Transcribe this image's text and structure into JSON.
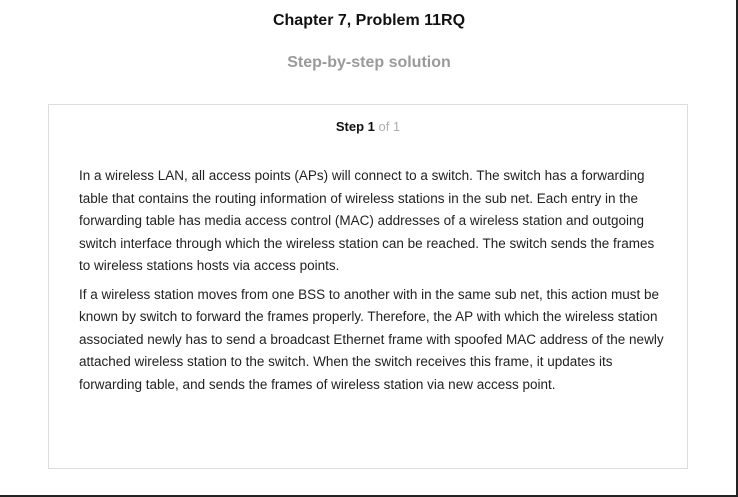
{
  "header": {
    "title": "Chapter 7, Problem 11RQ",
    "subtitle": "Step-by-step solution"
  },
  "step": {
    "label": "Step 1",
    "count": " of 1"
  },
  "solution": {
    "paragraphs": [
      "In a wireless LAN, all access points (APs) will connect to a switch. The switch has a forwarding table that contains the routing information of wireless stations in the sub net. Each entry in the forwarding table has media access control (MAC) addresses of a wireless station and outgoing switch interface through which the wireless station can be reached. The switch sends the frames to wireless stations hosts via access points.",
      "If a wireless station moves from one BSS to another with in the same sub net, this action must be known by switch to forward the frames properly. Therefore, the AP with which the wireless station associated newly has to send a broadcast Ethernet frame with spoofed MAC address of the newly attached wireless station to the switch. When the switch receives this frame, it updates its forwarding table, and sends the frames of wireless station via new access point."
    ]
  }
}
